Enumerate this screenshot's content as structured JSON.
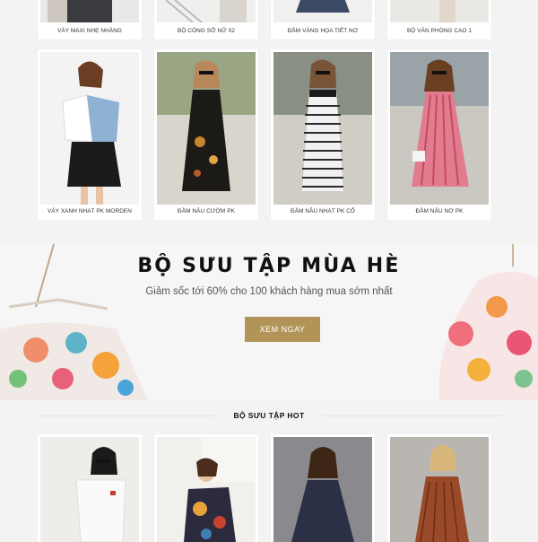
{
  "top_row": {
    "items": [
      {
        "label": "VÁY MAXI NHẸ NHÀNG"
      },
      {
        "label": "BỘ CÔNG SỞ NỮ 02"
      },
      {
        "label": "ĐẦM VÀNG HỌA TIẾT NƠ"
      },
      {
        "label": "BỘ VĂN PHÒNG CAO 1"
      }
    ]
  },
  "second_row": {
    "items": [
      {
        "label": "VÁY XANH NHẠT PK MORDEN"
      },
      {
        "label": "ĐẦM NÂU CƯỜM PK"
      },
      {
        "label": "ĐẦM NÂU NHẠT PK CỔ"
      },
      {
        "label": "ĐẦM NÂU NƠ PK"
      }
    ]
  },
  "banner": {
    "title": "BỘ SƯU TẬP MÙA HÈ",
    "subtitle": "Giảm sốc tới 60% cho 100 khách hàng mua sớm nhất",
    "button": "XEM NGAY"
  },
  "hot_section": {
    "title": "BỘ SƯU TẬP HOT"
  },
  "colors": {
    "accent": "#b39458",
    "page_bg": "#f4f3f3"
  }
}
